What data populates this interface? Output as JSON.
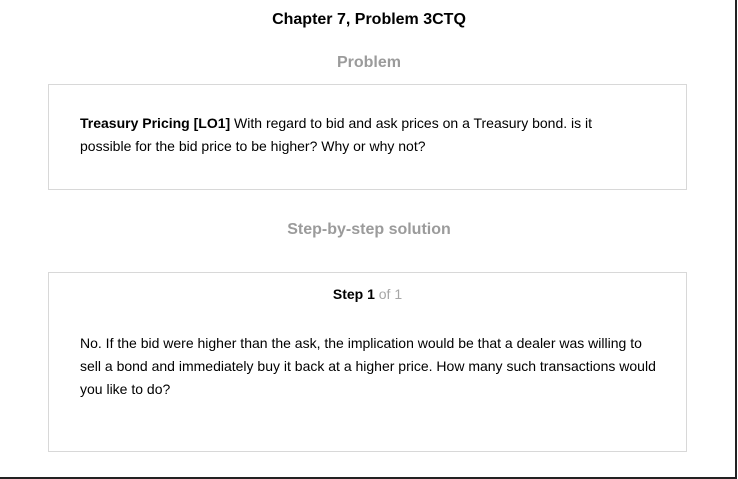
{
  "page": {
    "title": "Chapter 7, Problem 3CTQ"
  },
  "problem": {
    "heading": "Problem",
    "lead": "Treasury Pricing [LO1]",
    "text": " With regard to bid and ask prices on a Treasury bond. is it possible for the bid price to be higher? Why or why not?"
  },
  "solution": {
    "heading": "Step-by-step solution",
    "step_label": "Step 1",
    "step_of": " of 1",
    "text": "No. If the bid were higher than the ask, the implication would be that a dealer was willing to sell a bond and immediately buy it back at a higher price. How many such transactions would you like to do?"
  },
  "colors": {
    "heading_gray": "#9b9b9b",
    "border": "#d8d8d8",
    "step_of_gray": "#a6a6a6"
  }
}
